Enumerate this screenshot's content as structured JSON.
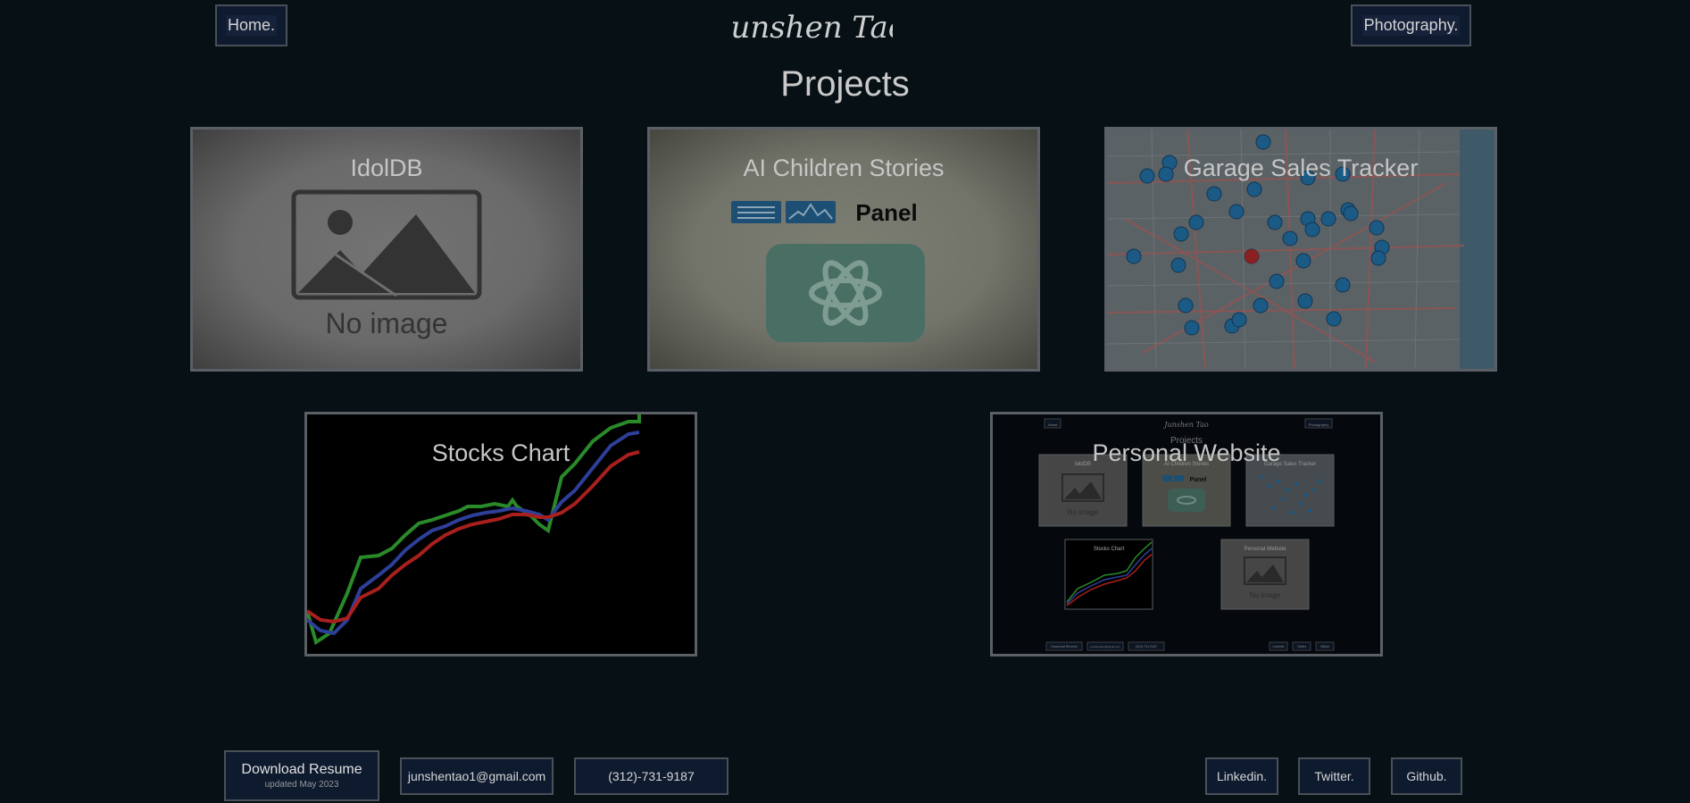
{
  "header": {
    "home_label": "Home.",
    "photography_label": "Photography.",
    "logo_text": "Junshen Tao",
    "page_title": "Projects"
  },
  "projects": [
    {
      "title": "IdolDB",
      "image": "No image"
    },
    {
      "title": "AI Children Stories",
      "image_logos": [
        "Panel",
        "openai-icon"
      ]
    },
    {
      "title": "Garage Sales Tracker",
      "image": "map-with-markers"
    },
    {
      "title": "Stocks Chart",
      "image": "line-chart"
    },
    {
      "title": "Personal Website",
      "image": "site-screenshot",
      "mini": {
        "home": "Home",
        "photography": "Photography",
        "title": "Projects",
        "cards": [
          "IdolDB",
          "AI Children Stories",
          "Garage Sales Tracker",
          "Stocks Chart",
          "Personal Website"
        ],
        "no_image": "No image",
        "footer": [
          "Download Resume",
          "junshentao1@gmail.com",
          "(312)-731-9187",
          "Linkedin",
          "Twitter",
          "Github"
        ]
      }
    }
  ],
  "footer": {
    "resume_label": "Download Resume",
    "resume_updated": "updated May 2023",
    "email": "junshentao1@gmail.com",
    "phone": "(312)-731-9187",
    "linkedin": "Linkedin.",
    "twitter": "Twitter.",
    "github": "Github."
  },
  "colors": {
    "background": "#061015",
    "button_bg": "#0e1a2e",
    "border": "#4b4f57",
    "stock_green": "#2a8a2a",
    "stock_blue": "#2e3f9a",
    "stock_red": "#a8201e",
    "map_marker": "#1c5a86"
  }
}
